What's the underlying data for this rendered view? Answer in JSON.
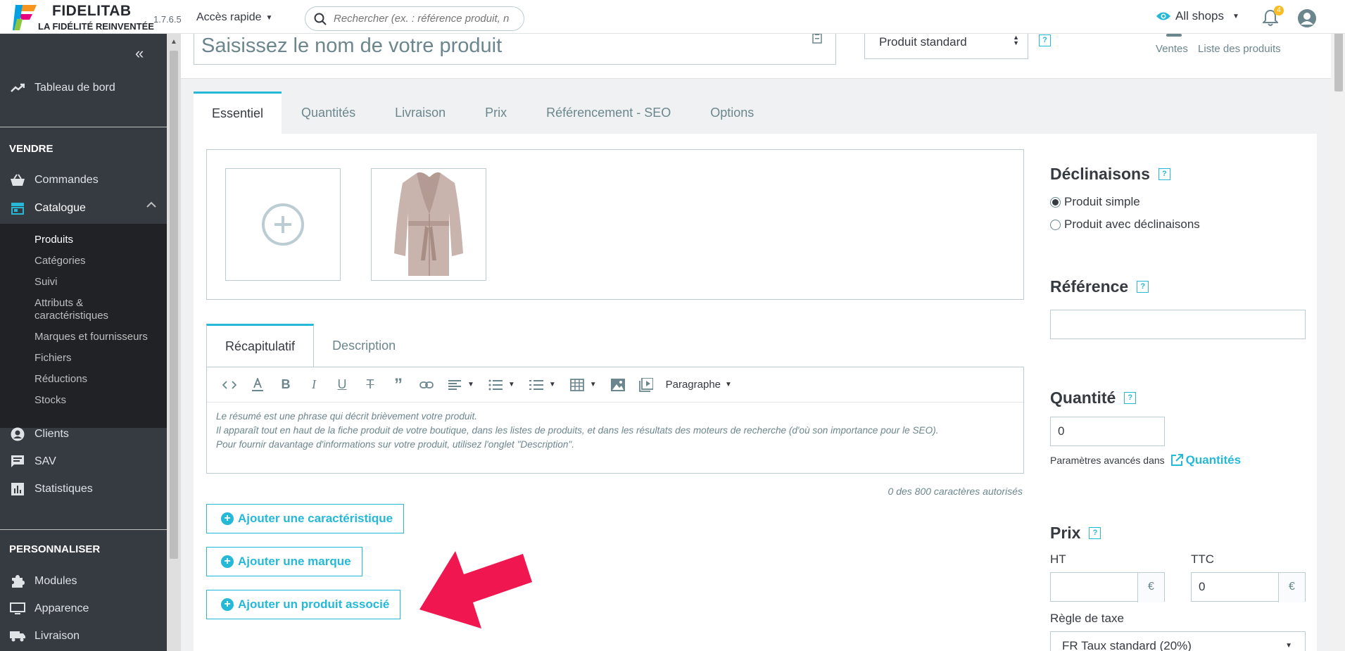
{
  "header": {
    "logo_name": "FIDELITAB",
    "logo_tagline": "LA FIDÉLITÉ REINVENTÉE",
    "version": "1.7.6.5",
    "quick_access": "Accès rapide",
    "search_placeholder": "Rechercher (ex. : référence produit, nom",
    "shop_selector": "All shops",
    "notification_count": "4",
    "accent_color": "#25b9d7"
  },
  "sidebar": {
    "dashboard": "Tableau de bord",
    "section_sell": "VENDRE",
    "orders": "Commandes",
    "catalog": "Catalogue",
    "catalog_sub": [
      "Produits",
      "Catégories",
      "Suivi",
      "Attributs & caractéristiques",
      "Marques et fournisseurs",
      "Fichiers",
      "Réductions",
      "Stocks"
    ],
    "clients": "Clients",
    "sav": "SAV",
    "stats": "Statistiques",
    "section_custom": "PERSONNALISER",
    "modules": "Modules",
    "appearance": "Apparence",
    "shipping": "Livraison"
  },
  "product": {
    "name_placeholder": "Saisissez le nom de votre produit",
    "type": "Produit standard",
    "top_link_sales": "Ventes",
    "top_link_list": "Liste des produits",
    "help_glyph": "?"
  },
  "tabs": [
    "Essentiel",
    "Quantités",
    "Livraison",
    "Prix",
    "Référencement - SEO",
    "Options"
  ],
  "editor": {
    "tabs": [
      "Récapitulatif",
      "Description"
    ],
    "paragraph_format": "Paragraphe",
    "placeholder_lines": [
      "Le résumé est une phrase qui décrit brièvement votre produit.",
      "Il apparaît tout en haut de la fiche produit de votre boutique, dans les listes de produits, et dans les résultats des moteurs de recherche (d'où son importance pour le SEO).",
      "Pour fournir davantage d'informations sur votre produit, utilisez l'onglet \"Description\"."
    ],
    "counter": "0 des 800 caractères autorisés"
  },
  "actions": {
    "add_feature": "Ajouter une caractéristique",
    "add_brand": "Ajouter une marque",
    "add_related": "Ajouter un produit associé"
  },
  "right": {
    "combinations_title": "Déclinaisons",
    "simple_product": "Produit simple",
    "with_combinations": "Produit avec déclinaisons",
    "reference_title": "Référence",
    "reference_value": "",
    "quantity_title": "Quantité",
    "quantity_value": "0",
    "advanced_params": "Paramètres avancés dans",
    "quantities_link": "Quantités",
    "price_title": "Prix",
    "ht_label": "HT",
    "ttc_label": "TTC",
    "ht_value": "",
    "ttc_value": "0",
    "currency": "€",
    "tax_rule_label": "Règle de taxe",
    "tax_rule_value": "FR Taux standard (20%)"
  }
}
